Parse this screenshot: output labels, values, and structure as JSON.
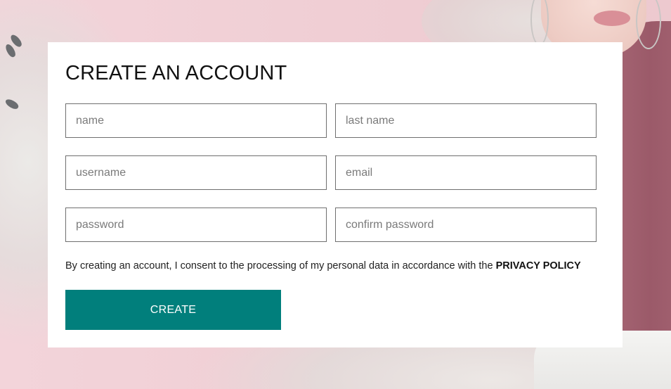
{
  "form": {
    "title": "CREATE AN ACCOUNT",
    "fields": {
      "name": {
        "placeholder": "name",
        "value": ""
      },
      "last_name": {
        "placeholder": "last name",
        "value": ""
      },
      "username": {
        "placeholder": "username",
        "value": ""
      },
      "email": {
        "placeholder": "email",
        "value": ""
      },
      "password": {
        "placeholder": "password",
        "value": ""
      },
      "confirm_password": {
        "placeholder": "confirm password",
        "value": ""
      }
    },
    "consent_text": "By creating an account, I consent to the processing of my personal data in accordance with the ",
    "privacy_link": "PRIVACY POLICY",
    "submit_label": "CREATE"
  },
  "colors": {
    "accent": "#017f7c",
    "background_pink": "#f0d0d6",
    "card": "#ffffff"
  }
}
